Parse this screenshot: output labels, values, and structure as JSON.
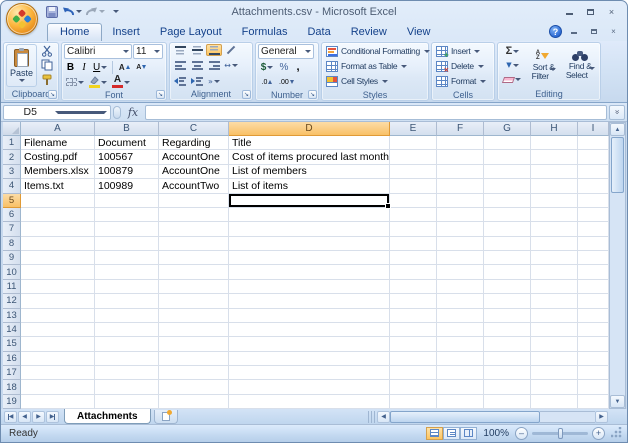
{
  "window": {
    "title": "Attachments.csv - Microsoft Excel"
  },
  "icons": {
    "close": "×",
    "help": "?",
    "launcher": "↘",
    "scroll_up": "▲",
    "scroll_down": "▼",
    "scroll_left": "◀",
    "scroll_right": "▶",
    "tab_first": "◀",
    "tab_prev": "◀",
    "tab_next": "▶",
    "tab_last": "▶",
    "chevron": "»",
    "fill_down": "▼",
    "merge_arrows": "↔",
    "zoom_out": "–",
    "zoom_in": "+",
    "sort_a": "A",
    "sort_z": "Z"
  },
  "colors": {
    "selection_header_highlight": "#f9c167",
    "active_button_highlight": "#fdc45f",
    "accent_orange": "#f0a830"
  },
  "ribbon": {
    "tabs": [
      {
        "label": "Home",
        "active": true
      },
      {
        "label": "Insert",
        "active": false
      },
      {
        "label": "Page Layout",
        "active": false
      },
      {
        "label": "Formulas",
        "active": false
      },
      {
        "label": "Data",
        "active": false
      },
      {
        "label": "Review",
        "active": false
      },
      {
        "label": "View",
        "active": false
      }
    ],
    "clipboard": {
      "label": "Clipboard",
      "paste": "Paste"
    },
    "font": {
      "label": "Font",
      "family": "Calibri",
      "size": "11",
      "bold": "B",
      "italic": "I",
      "underline": "U",
      "grow": "A",
      "shrink": "A"
    },
    "alignment": {
      "label": "Alignment"
    },
    "number": {
      "label": "Number",
      "format": "General",
      "currency": "$",
      "percent": "%",
      "comma": ",",
      "inc_decimal": ".0",
      "dec_decimal": ".00"
    },
    "styles": {
      "label": "Styles",
      "conditional_formatting": "Conditional Formatting",
      "format_as_table": "Format as Table",
      "cell_styles": "Cell Styles"
    },
    "cells": {
      "label": "Cells",
      "insert": "Insert",
      "delete": "Delete",
      "format": "Format"
    },
    "editing": {
      "label": "Editing",
      "autosum": "Σ",
      "sort_filter_line1": "Sort &",
      "sort_filter_line2": "Filter",
      "find_select_line1": "Find &",
      "find_select_line2": "Select"
    }
  },
  "formula_bar": {
    "name_box": "D5",
    "fx": "fx"
  },
  "sheet": {
    "columns": [
      "A",
      "B",
      "C",
      "D",
      "E",
      "F",
      "G",
      "H",
      "I"
    ],
    "row_count": 19,
    "selected_cell": "D5",
    "selected_column": "D",
    "selected_row": 5,
    "cells": {
      "A1": "Filename",
      "B1": "Document",
      "C1": "Regarding",
      "D1": "Title",
      "A2": "Costing.pdf",
      "B2": "100567",
      "C2": "AccountOne",
      "D2": "Cost of items procured last month",
      "A3": "Members.xlsx",
      "B3": "100879",
      "C3": "AccountOne",
      "D3": "List of members",
      "A4": "Items.txt",
      "B4": "100989",
      "C4": "AccountTwo",
      "D4": "List of items"
    }
  },
  "sheet_tabs": {
    "active": "Attachments"
  },
  "status_bar": {
    "status": "Ready",
    "zoom_level": "100%"
  }
}
